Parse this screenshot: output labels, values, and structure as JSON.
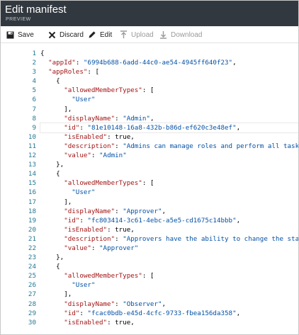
{
  "header": {
    "title": "Edit manifest",
    "subtitle": "PREVIEW"
  },
  "toolbar": {
    "save_label": "Save",
    "discard_label": "Discard",
    "edit_label": "Edit",
    "upload_label": "Upload",
    "download_label": "Download"
  },
  "editor": {
    "cursor_line": 9,
    "lines": [
      "{",
      "  \"appId\": \"6994b688-6add-44c0-ae54-4945ff640f23\",",
      "  \"appRoles\": [",
      "    {",
      "      \"allowedMemberTypes\": [",
      "        \"User\"",
      "      ],",
      "      \"displayName\": \"Admin\",",
      "      \"id\": \"81e10148-16a8-432b-b86d-ef620c3e48ef\",",
      "      \"isEnabled\": true,",
      "      \"description\": \"Admins can manage roles and perform all task",
      "      \"value\": \"Admin\"",
      "    },",
      "    {",
      "      \"allowedMemberTypes\": [",
      "        \"User\"",
      "      ],",
      "      \"displayName\": \"Approver\",",
      "      \"id\": \"fc803414-3c61-4ebc-a5e5-cd1675c14bbb\",",
      "      \"isEnabled\": true,",
      "      \"description\": \"Approvers have the ability to change the stat",
      "      \"value\": \"Approver\"",
      "    },",
      "    {",
      "      \"allowedMemberTypes\": [",
      "        \"User\"",
      "      ],",
      "      \"displayName\": \"Observer\",",
      "      \"id\": \"fcac0bdb-e45d-4cfc-9733-fbea156da358\",",
      "      \"isEnabled\": true,"
    ]
  }
}
